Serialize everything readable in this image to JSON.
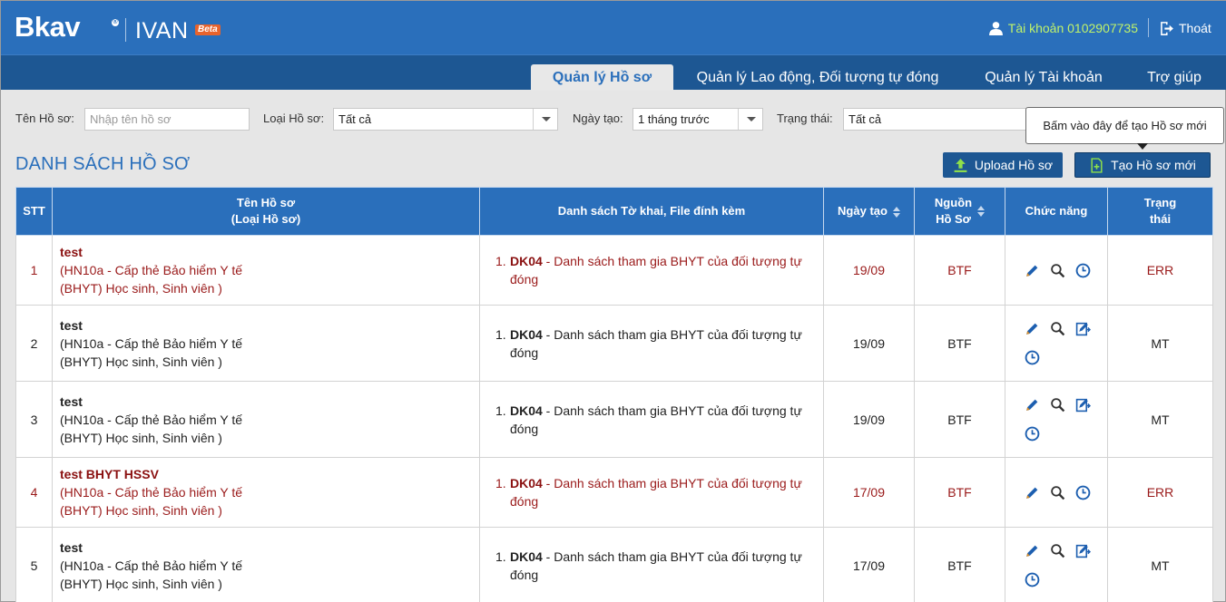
{
  "header": {
    "logo": "Bkav",
    "logo_mark": "®",
    "product": "IVAN",
    "badge": "Beta",
    "account": "Tài khoản 0102907735",
    "logout": "Thoát"
  },
  "nav": {
    "tabs": [
      {
        "label": "Quản lý Hồ sơ",
        "active": true
      },
      {
        "label": "Quản lý Lao động, Đối tượng tự đóng",
        "active": false
      },
      {
        "label": "Quản lý Tài khoản",
        "active": false
      },
      {
        "label": "Trợ giúp",
        "active": false
      }
    ]
  },
  "filters": {
    "name_label": "Tên Hồ sơ:",
    "name_placeholder": "Nhập tên hồ sơ",
    "type_label": "Loại Hồ sơ:",
    "type_value": "Tất cả",
    "date_label": "Ngày tạo:",
    "date_value": "1 tháng trước",
    "status_label": "Trạng thái:",
    "status_value": "Tất cả"
  },
  "tooltip": "Bấm vào đây để tạo Hồ sơ mới",
  "list": {
    "title": "DANH SÁCH HỒ SƠ",
    "upload_label": "Upload Hồ sơ",
    "create_label": "Tạo Hồ sơ mới"
  },
  "table": {
    "headers": {
      "stt": "STT",
      "name_line1": "Tên Hồ sơ",
      "name_line2": "(Loại Hồ sơ)",
      "docs": "Danh sách Tờ khai, File đính kèm",
      "date": "Ngày tạo",
      "source_line1": "Nguồn",
      "source_line2": "Hồ Sơ",
      "functions": "Chức năng",
      "status_line1": "Trạng",
      "status_line2": "thái"
    },
    "rows": [
      {
        "stt": "1",
        "name": "test",
        "type_line1": "(HN10a - Cấp thẻ Bảo hiểm Y tế",
        "type_line2": "(BHYT) Học sinh, Sinh viên )",
        "doc_num": "1.",
        "doc_code": "DK04",
        "doc_text_line1": " - Danh sách tham gia BHYT của đối tượng tự",
        "doc_text_line2": "đóng",
        "date": "19/09",
        "source": "BTF",
        "status": "ERR"
      },
      {
        "stt": "2",
        "name": "test",
        "type_line1": "(HN10a - Cấp thẻ Bảo hiểm Y tế",
        "type_line2": "(BHYT) Học sinh, Sinh viên )",
        "doc_num": "1.",
        "doc_code": "DK04",
        "doc_text_line1": " - Danh sách tham gia BHYT của đối tượng tự",
        "doc_text_line2": "đóng",
        "date": "19/09",
        "source": "BTF",
        "status": "MT"
      },
      {
        "stt": "3",
        "name": "test",
        "type_line1": "(HN10a - Cấp thẻ Bảo hiểm Y tế",
        "type_line2": "(BHYT) Học sinh, Sinh viên )",
        "doc_num": "1.",
        "doc_code": "DK04",
        "doc_text_line1": " - Danh sách tham gia BHYT của đối tượng tự",
        "doc_text_line2": "đóng",
        "date": "19/09",
        "source": "BTF",
        "status": "MT"
      },
      {
        "stt": "4",
        "name": "test BHYT HSSV",
        "type_line1": "(HN10a - Cấp thẻ Bảo hiểm Y tế",
        "type_line2": "(BHYT) Học sinh, Sinh viên )",
        "doc_num": "1.",
        "doc_code": "DK04",
        "doc_text_line1": " - Danh sách tham gia BHYT của đối tượng tự",
        "doc_text_line2": "đóng",
        "date": "17/09",
        "source": "BTF",
        "status": "ERR"
      },
      {
        "stt": "5",
        "name": "test",
        "type_line1": "(HN10a - Cấp thẻ Bảo hiểm Y tế",
        "type_line2": "(BHYT) Học sinh, Sinh viên )",
        "doc_num": "1.",
        "doc_code": "DK04",
        "doc_text_line1": " - Danh sách tham gia BHYT của đối tượng tự",
        "doc_text_line2": "đóng",
        "date": "17/09",
        "source": "BTF",
        "status": "MT"
      }
    ]
  },
  "icons": {
    "edit": "pencil-icon",
    "view": "magnifier-icon",
    "submit": "edit-export-icon",
    "history": "clock-icon"
  },
  "colors": {
    "header_blue": "#2a6fbb",
    "nav_dark_blue": "#1d5793",
    "account_green": "#bff26a",
    "error_red": "#9a1a1a",
    "beta_orange": "#e8632c"
  }
}
